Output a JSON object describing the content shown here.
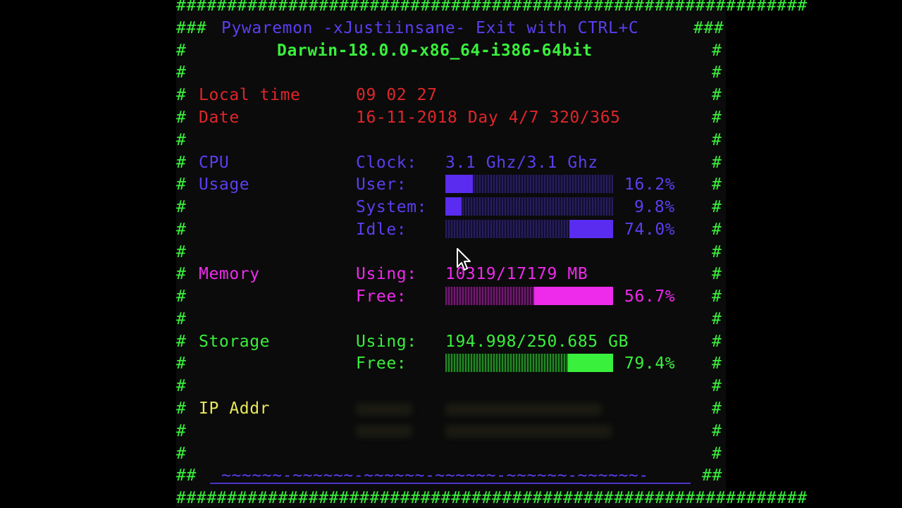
{
  "border": {
    "top": "##############################################################",
    "bottom": "##############################################################",
    "edge": "#",
    "double": "##",
    "triple": "###",
    "footer_wave": "~~~~~~-~~~~~~-~~~~~~-~~~~~~-~~~~~~-~~~~~~-"
  },
  "header": {
    "title": "Pywaremon -xJustiinsane- Exit with CTRL+C",
    "system": "Darwin-18.0.0-x86_64-i386-64bit"
  },
  "time": {
    "local_label": "Local time",
    "local_value": "09 02 27",
    "date_label": "Date",
    "date_value": "16-11-2018 Day 4/7 320/365"
  },
  "cpu": {
    "label": "CPU",
    "usage_label": "Usage",
    "clock_label": "Clock:",
    "clock_value": "3.1 Ghz/3.1 Ghz",
    "rows": [
      {
        "label": "User:",
        "percent": "16.2%",
        "fraction": 0.162,
        "side": "left"
      },
      {
        "label": "System:",
        "percent": "9.8%",
        "fraction": 0.098,
        "side": "left"
      },
      {
        "label": "Idle:",
        "percent": "74.0%",
        "fraction": 0.26,
        "side": "right"
      }
    ]
  },
  "memory": {
    "label": "Memory",
    "using_label": "Using:",
    "using_value": "10319/17179 MB",
    "free_label": "Free:",
    "free_percent": "56.7%",
    "free_fraction": 0.47
  },
  "storage": {
    "label": "Storage",
    "using_label": "Using:",
    "using_value": "194.998/250.685 GB",
    "free_label": "Free:",
    "free_percent": "79.4%",
    "free_fraction": 0.27
  },
  "network": {
    "label": "IP Addr"
  },
  "colors": {
    "green": "#39f03c",
    "blue": "#5a3ff0",
    "red": "#e0262a",
    "magenta": "#ee2aeb",
    "yellow": "#e8e85a"
  },
  "icons": {
    "cursor": "mouse-pointer-icon"
  }
}
